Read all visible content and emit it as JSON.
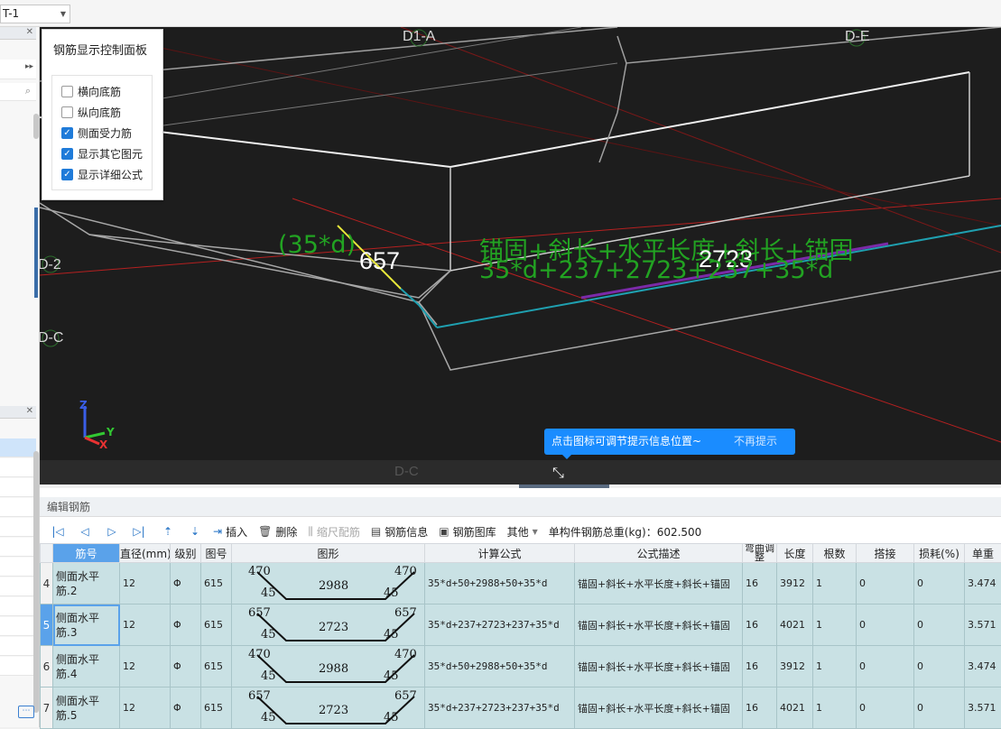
{
  "topbar": {
    "floor_value": "T-1"
  },
  "viewport": {
    "axis_labels": [
      "D1-A",
      "D-E",
      "D-2",
      "D-C",
      "D-C"
    ],
    "formula_desc": "锚固+斜长+水平长度+斜长+锚固",
    "formula_expr": "35*d+237+2723+237+35*d",
    "anchor_label": "(35*d)",
    "length_left": "657",
    "length_main": "2723",
    "axes": {
      "x": "X",
      "y": "Y",
      "z": "Z"
    }
  },
  "control_panel": {
    "title": "钢筋显示控制面板",
    "options": [
      {
        "label": "横向底筋",
        "checked": false
      },
      {
        "label": "纵向底筋",
        "checked": false
      },
      {
        "label": "侧面受力筋",
        "checked": true
      },
      {
        "label": "显示其它图元",
        "checked": true
      },
      {
        "label": "显示详细公式",
        "checked": true
      }
    ]
  },
  "tooltip": {
    "text": "点击图标可调节提示信息位置~",
    "dismiss": "不再提示"
  },
  "edit_panel": {
    "title": "编辑钢筋",
    "toolbar": {
      "insert": "插入",
      "delete": "删除",
      "scale": "缩尺配筋",
      "info": "钢筋信息",
      "library": "钢筋图库",
      "other": "其他",
      "total_weight": "单构件钢筋总重(kg)：602.500"
    },
    "columns": [
      "筋号",
      "直径(mm)",
      "级别",
      "图号",
      "图形",
      "计算公式",
      "公式描述",
      "弯曲调整",
      "长度",
      "根数",
      "搭接",
      "损耗(%)",
      "单重"
    ],
    "rows": [
      {
        "num": "4",
        "name": "侧面水平筋.2",
        "diameter": "12",
        "grade": "Φ",
        "fig": "615",
        "shape": {
          "top_left": "470",
          "top_right": "470",
          "bottom_left": "45",
          "bottom_right": "45",
          "middle": "2988"
        },
        "formula": "35*d+50+2988+50+35*d",
        "desc": "锚固+斜长+水平长度+斜长+锚固",
        "bend": "16",
        "length": "3912",
        "count": "1",
        "lap": "0",
        "loss": "0",
        "weight": "3.474"
      },
      {
        "num": "5",
        "name": "侧面水平筋.3",
        "diameter": "12",
        "grade": "Φ",
        "fig": "615",
        "shape": {
          "top_left": "657",
          "top_right": "657",
          "bottom_left": "45",
          "bottom_right": "45",
          "middle": "2723"
        },
        "formula": "35*d+237+2723+237+35*d",
        "desc": "锚固+斜长+水平长度+斜长+锚固",
        "bend": "16",
        "length": "4021",
        "count": "1",
        "lap": "0",
        "loss": "0",
        "weight": "3.571"
      },
      {
        "num": "6",
        "name": "侧面水平筋.4",
        "diameter": "12",
        "grade": "Φ",
        "fig": "615",
        "shape": {
          "top_left": "470",
          "top_right": "470",
          "bottom_left": "45",
          "bottom_right": "45",
          "middle": "2988"
        },
        "formula": "35*d+50+2988+50+35*d",
        "desc": "锚固+斜长+水平长度+斜长+锚固",
        "bend": "16",
        "length": "3912",
        "count": "1",
        "lap": "0",
        "loss": "0",
        "weight": "3.474"
      },
      {
        "num": "7",
        "name": "侧面水平筋.5",
        "diameter": "12",
        "grade": "Φ",
        "fig": "615",
        "shape": {
          "top_left": "657",
          "top_right": "657",
          "bottom_left": "45",
          "bottom_right": "45",
          "middle": "2723"
        },
        "formula": "35*d+237+2723+237+35*d",
        "desc": "锚固+斜长+水平长度+斜长+锚固",
        "bend": "16",
        "length": "4021",
        "count": "1",
        "lap": "0",
        "loss": "0",
        "weight": "3.571"
      }
    ]
  }
}
